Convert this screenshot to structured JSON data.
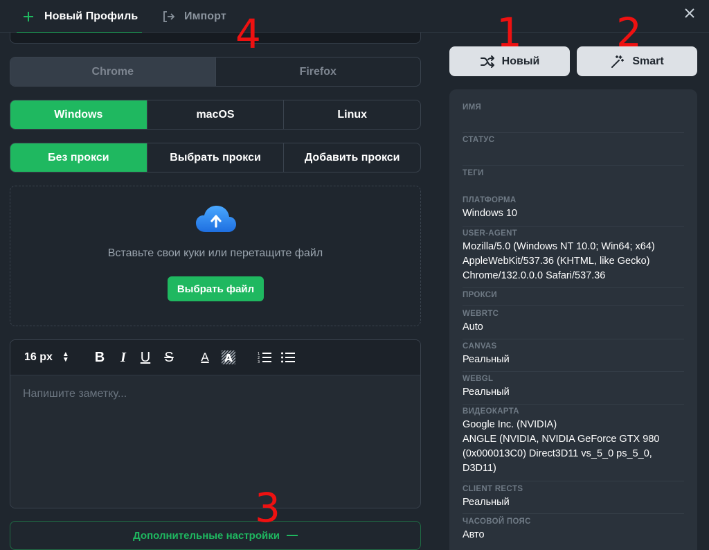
{
  "header": {
    "tab_new": "Новый Профиль",
    "tab_import": "Импорт"
  },
  "browser": {
    "options": [
      "Chrome",
      "Firefox"
    ]
  },
  "os": {
    "options": [
      "Windows",
      "macOS",
      "Linux"
    ],
    "selected": "Windows"
  },
  "proxy": {
    "options": [
      "Без прокси",
      "Выбрать прокси",
      "Добавить прокси"
    ],
    "selected": "Без прокси"
  },
  "cookies": {
    "text": "Вставьте свои куки или перетащите файл",
    "button": "Выбрать файл"
  },
  "editor": {
    "font_size": "16 px",
    "placeholder": "Напишите заметку..."
  },
  "advanced": {
    "label": "Дополнительные настройки"
  },
  "actions": {
    "new_label": "Новый",
    "smart_label": "Smart"
  },
  "info": {
    "name_label": "ИМЯ",
    "status_label": "СТАТУС",
    "tags_label": "ТЕГИ",
    "platform_label": "ПЛАТФОРМА",
    "platform_value": "Windows 10",
    "useragent_label": "USER-AGENT",
    "useragent_line1": "Mozilla/5.0 (Windows NT 10.0; Win64; x64)",
    "useragent_line2": "AppleWebKit/537.36 (KHTML, like Gecko)",
    "useragent_line3": "Chrome/132.0.0.0 Safari/537.36",
    "proxy_label": "ПРОКСИ",
    "webrtc_label": "WEBRTC",
    "webrtc_value": "Auto",
    "canvas_label": "CANVAS",
    "canvas_value": "Реальный",
    "webgl_label": "WEBGL",
    "webgl_value": "Реальный",
    "gpu_label": "ВИДЕОКАРТА",
    "gpu_line1": "Google Inc. (NVIDIA)",
    "gpu_line2": "ANGLE (NVIDIA, NVIDIA GeForce GTX 980",
    "gpu_line3": "(0x000013C0) Direct3D11 vs_5_0 ps_5_0,",
    "gpu_line4": "D3D11)",
    "rects_label": "CLIENT RECTS",
    "rects_value": "Реальный",
    "tz_label": "ЧАСОВОЙ ПОЯС",
    "tz_value": "Авто"
  },
  "markers": {
    "m1": "1",
    "m2": "2",
    "m3": "3",
    "m4": "4"
  },
  "colors": {
    "accent": "#1fb860",
    "background": "#1f262e",
    "panel": "#2a323b",
    "marker": "#ee1111"
  }
}
